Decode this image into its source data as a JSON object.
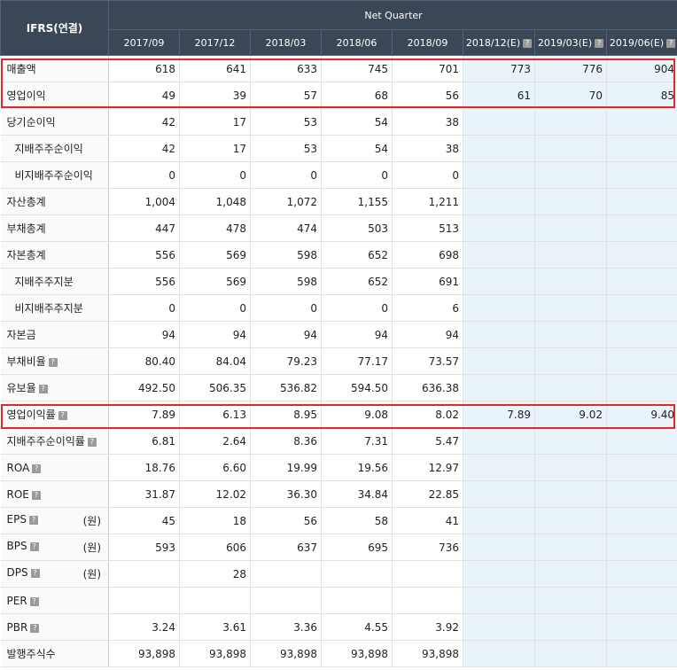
{
  "header": {
    "corner": "IFRS(연결)",
    "group": "Net Quarter",
    "periods": [
      "2017/09",
      "2017/12",
      "2018/03",
      "2018/06",
      "2018/09",
      "2018/12(E)",
      "2019/03(E)",
      "2019/06(E)"
    ]
  },
  "help_icon": "?",
  "rows": [
    {
      "label": "매출액",
      "sub": false,
      "help": false,
      "unit": "",
      "values": [
        "618",
        "641",
        "633",
        "745",
        "701",
        "773",
        "776",
        "904"
      ]
    },
    {
      "label": "영업이익",
      "sub": false,
      "help": false,
      "unit": "",
      "values": [
        "49",
        "39",
        "57",
        "68",
        "56",
        "61",
        "70",
        "85"
      ]
    },
    {
      "label": "당기순이익",
      "sub": false,
      "help": false,
      "unit": "",
      "values": [
        "42",
        "17",
        "53",
        "54",
        "38",
        "",
        "",
        ""
      ]
    },
    {
      "label": "지배주주순이익",
      "sub": true,
      "help": false,
      "unit": "",
      "values": [
        "42",
        "17",
        "53",
        "54",
        "38",
        "",
        "",
        ""
      ]
    },
    {
      "label": "비지배주주순이익",
      "sub": true,
      "help": false,
      "unit": "",
      "values": [
        "0",
        "0",
        "0",
        "0",
        "0",
        "",
        "",
        ""
      ]
    },
    {
      "label": "자산총계",
      "sub": false,
      "help": false,
      "unit": "",
      "values": [
        "1,004",
        "1,048",
        "1,072",
        "1,155",
        "1,211",
        "",
        "",
        ""
      ]
    },
    {
      "label": "부채총계",
      "sub": false,
      "help": false,
      "unit": "",
      "values": [
        "447",
        "478",
        "474",
        "503",
        "513",
        "",
        "",
        ""
      ]
    },
    {
      "label": "자본총계",
      "sub": false,
      "help": false,
      "unit": "",
      "values": [
        "556",
        "569",
        "598",
        "652",
        "698",
        "",
        "",
        ""
      ]
    },
    {
      "label": "지배주주지분",
      "sub": true,
      "help": false,
      "unit": "",
      "values": [
        "556",
        "569",
        "598",
        "652",
        "691",
        "",
        "",
        ""
      ]
    },
    {
      "label": "비지배주주지분",
      "sub": true,
      "help": false,
      "unit": "",
      "values": [
        "0",
        "0",
        "0",
        "0",
        "6",
        "",
        "",
        ""
      ]
    },
    {
      "label": "자본금",
      "sub": false,
      "help": false,
      "unit": "",
      "values": [
        "94",
        "94",
        "94",
        "94",
        "94",
        "",
        "",
        ""
      ]
    },
    {
      "label": "부채비율",
      "sub": false,
      "help": true,
      "unit": "",
      "values": [
        "80.40",
        "84.04",
        "79.23",
        "77.17",
        "73.57",
        "",
        "",
        ""
      ]
    },
    {
      "label": "유보율",
      "sub": false,
      "help": true,
      "unit": "",
      "values": [
        "492.50",
        "506.35",
        "536.82",
        "594.50",
        "636.38",
        "",
        "",
        ""
      ]
    },
    {
      "label": "영업이익률",
      "sub": false,
      "help": true,
      "unit": "",
      "values": [
        "7.89",
        "6.13",
        "8.95",
        "9.08",
        "8.02",
        "7.89",
        "9.02",
        "9.40"
      ]
    },
    {
      "label": "지배주주순이익률",
      "sub": false,
      "help": true,
      "unit": "",
      "values": [
        "6.81",
        "2.64",
        "8.36",
        "7.31",
        "5.47",
        "",
        "",
        ""
      ]
    },
    {
      "label": "ROA",
      "sub": false,
      "help": true,
      "unit": "",
      "values": [
        "18.76",
        "6.60",
        "19.99",
        "19.56",
        "12.97",
        "",
        "",
        ""
      ]
    },
    {
      "label": "ROE",
      "sub": false,
      "help": true,
      "unit": "",
      "values": [
        "31.87",
        "12.02",
        "36.30",
        "34.84",
        "22.85",
        "",
        "",
        ""
      ]
    },
    {
      "label": "EPS",
      "sub": false,
      "help": true,
      "unit": "(원)",
      "values": [
        "45",
        "18",
        "56",
        "58",
        "41",
        "",
        "",
        ""
      ]
    },
    {
      "label": "BPS",
      "sub": false,
      "help": true,
      "unit": "(원)",
      "values": [
        "593",
        "606",
        "637",
        "695",
        "736",
        "",
        "",
        ""
      ]
    },
    {
      "label": "DPS",
      "sub": false,
      "help": true,
      "unit": "(원)",
      "values": [
        "",
        "28",
        "",
        "",
        "",
        "",
        "",
        ""
      ]
    },
    {
      "label": "PER",
      "sub": false,
      "help": true,
      "unit": "",
      "values": [
        "",
        "",
        "",
        "",
        "",
        "",
        "",
        ""
      ]
    },
    {
      "label": "PBR",
      "sub": false,
      "help": true,
      "unit": "",
      "values": [
        "3.24",
        "3.61",
        "3.36",
        "4.55",
        "3.92",
        "",
        "",
        ""
      ]
    },
    {
      "label": "발행주식수",
      "sub": false,
      "help": false,
      "unit": "",
      "values": [
        "93,898",
        "93,898",
        "93,898",
        "93,898",
        "93,898",
        "",
        "",
        ""
      ]
    }
  ],
  "colors": {
    "header_bg": "#3b4756",
    "estimate_bg": "#e8f4fa",
    "highlight_border": "#e02a2a"
  }
}
